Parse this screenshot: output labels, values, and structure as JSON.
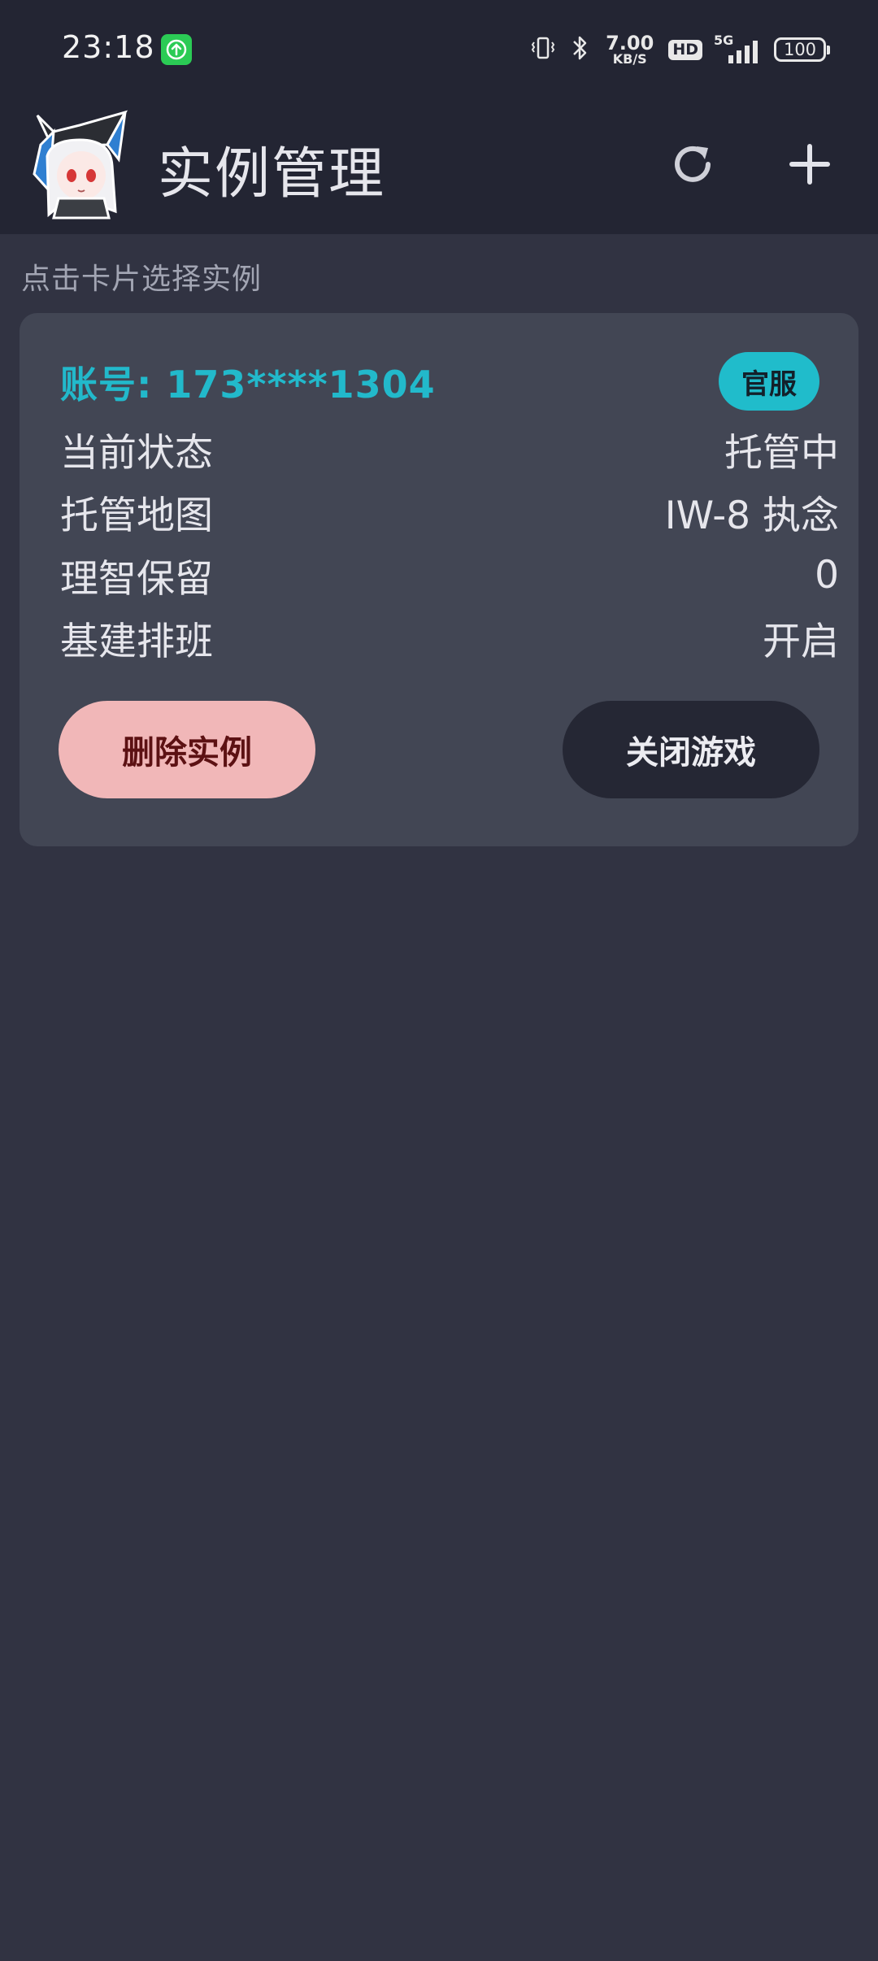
{
  "status_bar": {
    "time": "23:18",
    "network_speed_value": "7.00",
    "network_speed_unit": "KB/S",
    "hd_label": "HD",
    "network_type": "5G",
    "battery": "100"
  },
  "app_bar": {
    "title": "实例管理",
    "actions": [
      "refresh-icon",
      "plus-icon"
    ]
  },
  "main": {
    "hint": "点击卡片选择实例",
    "card": {
      "account": "账号: 173****1304",
      "server_badge": "官服",
      "rows": [
        {
          "label": "当前状态",
          "value": "托管中"
        },
        {
          "label": "托管地图",
          "value": "IW-8 执念"
        },
        {
          "label": "理智保留",
          "value": "0"
        },
        {
          "label": "基建排班",
          "value": "开启"
        }
      ],
      "delete_label": "删除实例",
      "close_label": "关闭游戏"
    }
  },
  "colors": {
    "background": "#313342",
    "app_bar": "#232533",
    "card": "#424654",
    "accent": "#22b9cb",
    "delete_button": "#f1b7b8",
    "close_button": "#252734"
  }
}
